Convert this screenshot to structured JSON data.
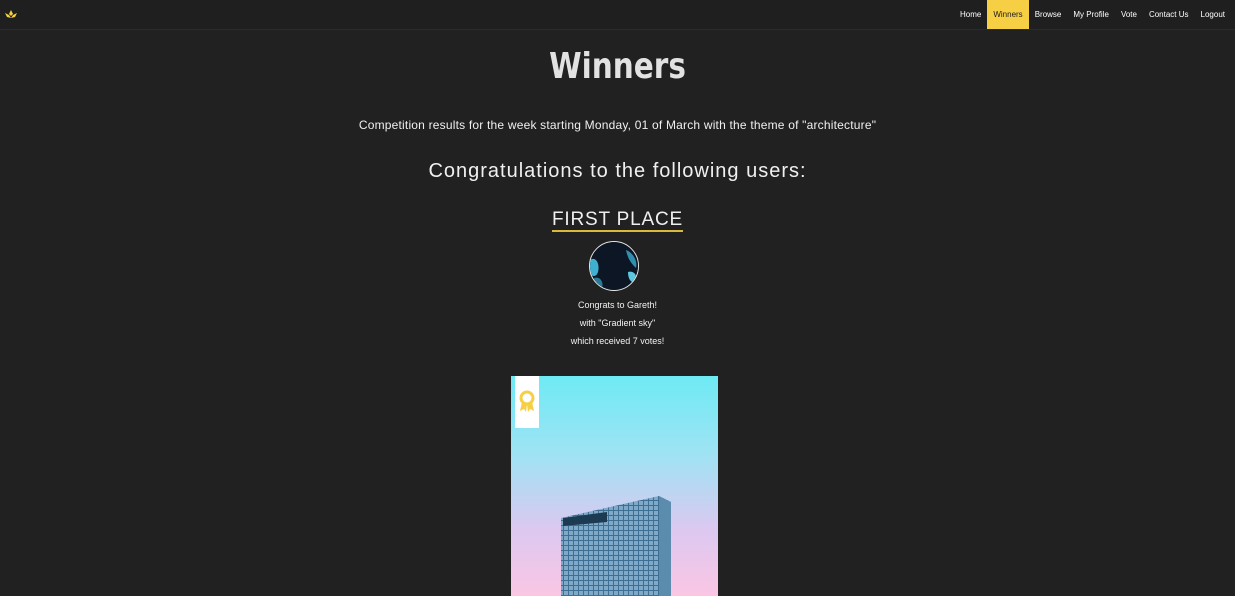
{
  "nav": {
    "logo_icon": "lotus-crown-icon",
    "items": [
      {
        "label": "Home",
        "active": false
      },
      {
        "label": "Winners",
        "active": true
      },
      {
        "label": "Browse",
        "active": false
      },
      {
        "label": "My Profile",
        "active": false
      },
      {
        "label": "Vote",
        "active": false
      },
      {
        "label": "Contact Us",
        "active": false
      },
      {
        "label": "Logout",
        "active": false
      }
    ]
  },
  "page": {
    "title": "Winners",
    "results_text": "Competition results for the week starting Monday, 01 of March with the theme of \"architecture\"",
    "congrats_heading": "Congratulations to the following users:"
  },
  "first_place": {
    "heading": "FIRST PLACE",
    "line1": "Congrats to Gareth!",
    "line2": "with \"Gradient sky\"",
    "line3": "which received 7 votes!",
    "award_icon": "award-ribbon-icon"
  },
  "colors": {
    "background": "#212121",
    "accent": "#f6cf45",
    "text": "#f0f0f0"
  }
}
